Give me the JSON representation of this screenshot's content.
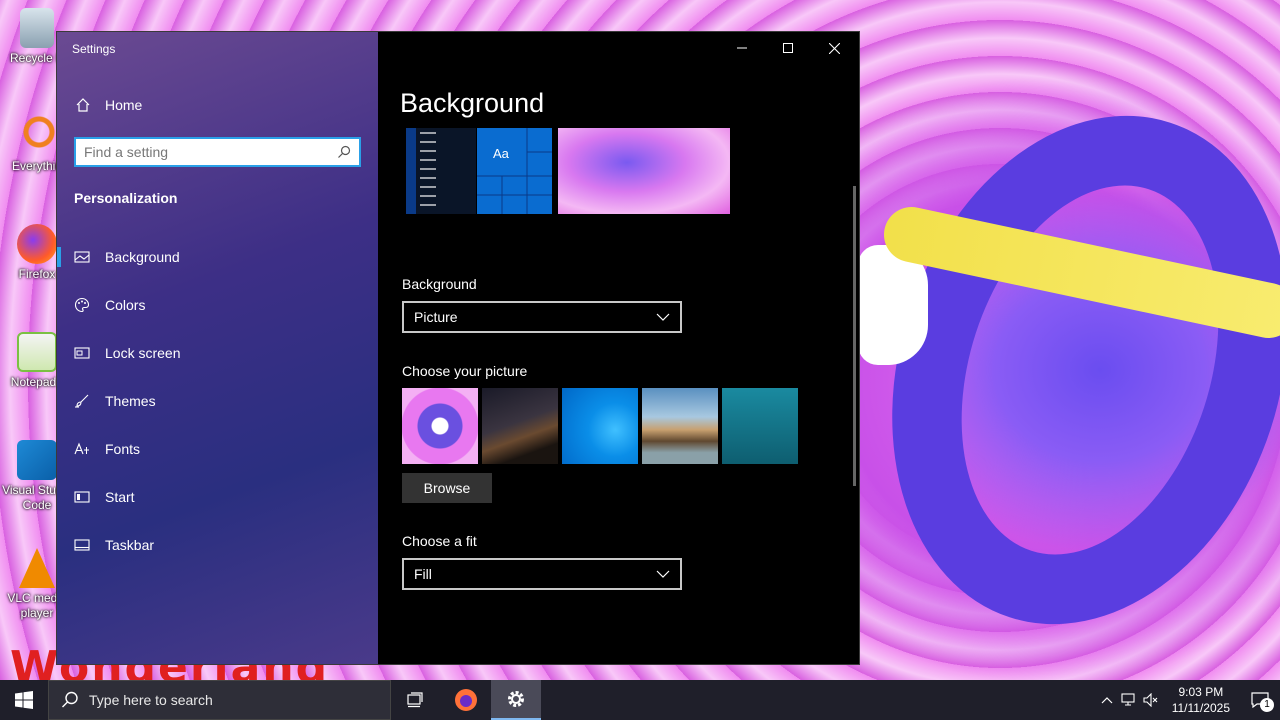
{
  "desktop": {
    "icons": [
      {
        "label": "Recycle B",
        "color": "#9fb8c8"
      },
      {
        "label": "Everythin",
        "color": "#f08020"
      },
      {
        "label": "Firefox",
        "color": "#ff7139"
      },
      {
        "label": "Notepad+",
        "color": "#7bc043"
      },
      {
        "label": "Visual Studio Code",
        "color": "#1e8ad6"
      },
      {
        "label": "VLC media player",
        "color": "#f08a00"
      }
    ],
    "wallpaper_text": "Wonderland"
  },
  "window": {
    "title": "Settings",
    "controls": {
      "minimize": "minimize-icon",
      "maximize": "maximize-icon",
      "close": "close-icon"
    }
  },
  "sidebar": {
    "home_label": "Home",
    "search_placeholder": "Find a setting",
    "section_title": "Personalization",
    "items": [
      {
        "label": "Background",
        "icon": "picture-icon",
        "active": true
      },
      {
        "label": "Colors",
        "icon": "palette-icon",
        "active": false
      },
      {
        "label": "Lock screen",
        "icon": "lock-screen-icon",
        "active": false
      },
      {
        "label": "Themes",
        "icon": "brush-icon",
        "active": false
      },
      {
        "label": "Fonts",
        "icon": "font-icon",
        "active": false
      },
      {
        "label": "Start",
        "icon": "start-icon",
        "active": false
      },
      {
        "label": "Taskbar",
        "icon": "taskbar-icon",
        "active": false
      }
    ]
  },
  "main": {
    "page_title": "Background",
    "preview_tile_label": "Aa",
    "background_label": "Background",
    "background_value": "Picture",
    "choose_picture_label": "Choose your picture",
    "browse_label": "Browse",
    "choose_fit_label": "Choose a fit",
    "fit_value": "Fill"
  },
  "taskbar": {
    "search_placeholder": "Type here to search",
    "time": "9:03 PM",
    "date": "11/11/2025",
    "notification_count": "1"
  }
}
